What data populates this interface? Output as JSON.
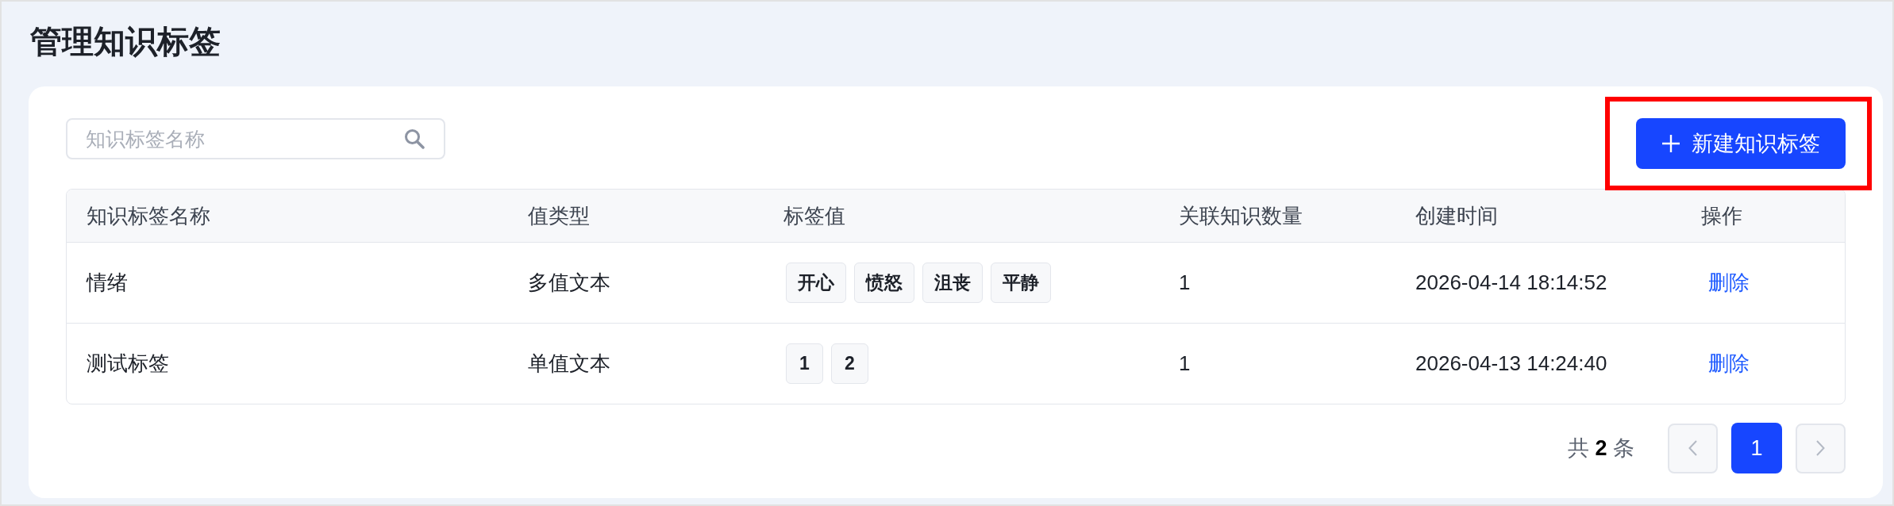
{
  "page": {
    "title": "管理知识标签"
  },
  "search": {
    "placeholder": "知识标签名称"
  },
  "create_button": {
    "label": "新建知识标签",
    "highlighted": true
  },
  "table": {
    "columns": [
      "知识标签名称",
      "值类型",
      "标签值",
      "关联知识数量",
      "创建时间",
      "操作"
    ],
    "rows": [
      {
        "name": "情绪",
        "value_type": "多值文本",
        "tag_values": [
          "开心",
          "愤怒",
          "沮丧",
          "平静"
        ],
        "linked_count": "1",
        "created_at": "2026-04-14 18:14:52",
        "action": "删除"
      },
      {
        "name": "测试标签",
        "value_type": "单值文本",
        "tag_values": [
          "1",
          "2"
        ],
        "linked_count": "1",
        "created_at": "2026-04-13 14:24:40",
        "action": "删除"
      }
    ]
  },
  "pagination": {
    "total_text": "共 **2** 条",
    "prev": {
      "disabled": true
    },
    "pages": [
      {
        "label": "1",
        "selected": true
      }
    ],
    "next": {
      "disabled": true
    }
  }
}
